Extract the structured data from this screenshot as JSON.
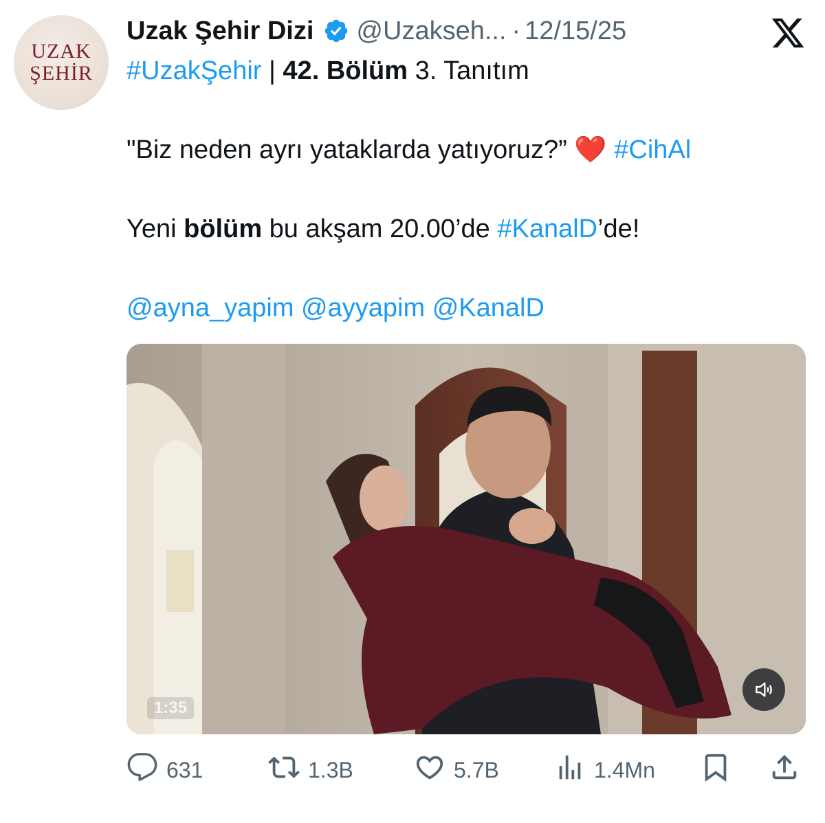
{
  "tweet": {
    "avatar": {
      "line1": "UZAK",
      "line2": "ŞEHİR"
    },
    "author": {
      "display_name": "Uzak Şehir Dizi",
      "handle": "@Uzakseh...",
      "separator": "·",
      "date": "12/15/25"
    },
    "lines": {
      "l1": {
        "hashtag": "#UzakŞehir",
        "sep": " | ",
        "bold": "42. Bölüm",
        "rest": " 3. Tanıtım"
      },
      "l2": {
        "quote": "\"Biz neden ayrı yataklarda yatıyoruz?”",
        "emoji": "❤️",
        "hashtag": "#CihAl"
      },
      "l3": {
        "t1": "Yeni ",
        "bold": "bölüm",
        "t2": " bu akşam 20.00’de ",
        "hashtag": "#KanalD",
        "t3": "’de!"
      },
      "l4": {
        "m1": "@ayna_yapim",
        "m2": "@ayyapim",
        "m3": "@KanalD"
      }
    },
    "media": {
      "timestamp": "1:35"
    },
    "actions": {
      "replies": "631",
      "reposts": "1.3B",
      "likes": "5.7B",
      "views": "1.4Mn"
    }
  },
  "colors": {
    "link": "#1d9bf0",
    "secondary_text": "#536471",
    "verified": "#1d9bf0",
    "avatar_text": "#7b1e2e"
  },
  "icons": [
    "verified-badge-icon",
    "x-logo-icon",
    "volume-icon",
    "reply-icon",
    "repost-icon",
    "like-icon",
    "views-icon",
    "bookmark-icon",
    "share-icon"
  ]
}
